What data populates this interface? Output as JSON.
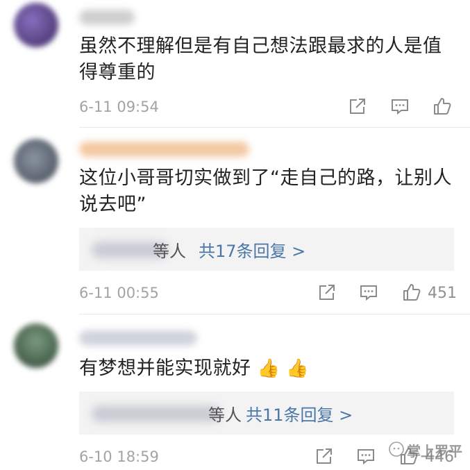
{
  "comments": [
    {
      "text": "虽然不理解但是有自己想法跟最求的人是值得尊重的",
      "time": "6-11 09:54",
      "like_count": "",
      "avatar_color": "#5a3f8c"
    },
    {
      "text": "这位小哥哥切实做到了“走自己的路，让别人说去吧”",
      "replies_suffix": "等人",
      "replies_link": "共17条回复 >",
      "time": "6-11 00:55",
      "like_count": "451",
      "avatar_color": "#5b6472"
    },
    {
      "text": "有梦想并能实现就好",
      "emoji": "👍 👍",
      "replies_suffix": "等人",
      "replies_link": "共11条回复 >",
      "time": "6-10 18:59",
      "like_count": "446",
      "avatar_color": "#4f6b55"
    }
  ],
  "icons": {
    "share": "share-icon",
    "comment": "comment-icon",
    "like": "like-icon"
  },
  "colors": {
    "link": "#4a76a8",
    "time": "#a3a3a3",
    "reply_bg": "#f3f3f3"
  },
  "watermark": {
    "text": "掌上罗平"
  }
}
